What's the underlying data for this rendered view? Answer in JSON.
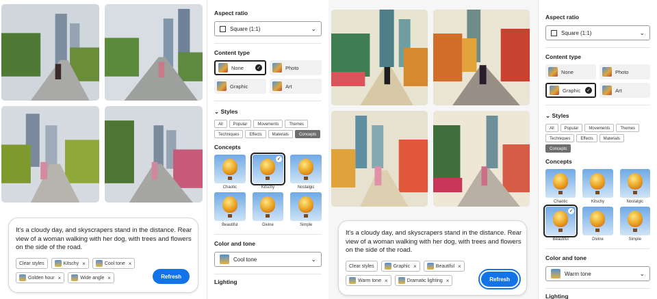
{
  "left": {
    "prompt": "It's a cloudy day, and skyscrapers stand in the distance. Rear view of a woman walking with her dog, with trees and flowers on the side of the road.",
    "chips": [
      {
        "label": "Clear styles",
        "icon": false,
        "remove": false
      },
      {
        "label": "Kitschy",
        "icon": true,
        "remove": true
      },
      {
        "label": "Cool tone",
        "icon": true,
        "remove": true
      },
      {
        "label": "Golden hour",
        "icon": true,
        "remove": true
      },
      {
        "label": "Wide angle",
        "icon": true,
        "remove": true
      }
    ],
    "refresh": "Refresh",
    "aspect_title": "Aspect ratio",
    "aspect_value": "Square (1:1)",
    "content_title": "Content type",
    "content": [
      {
        "label": "None",
        "selected": true
      },
      {
        "label": "Photo",
        "selected": false
      },
      {
        "label": "Graphic",
        "selected": false
      },
      {
        "label": "Art",
        "selected": false
      }
    ],
    "styles_title": "Styles",
    "tabs": [
      "All",
      "Popular",
      "Movements",
      "Themes",
      "Techniques",
      "Effects",
      "Materials",
      "Concepts"
    ],
    "active_tab": "Concepts",
    "concepts_title": "Concepts",
    "concepts": [
      {
        "label": "Chaotic",
        "selected": false
      },
      {
        "label": "Kitschy",
        "selected": true
      },
      {
        "label": "Nostalgic",
        "selected": false
      },
      {
        "label": "Beautiful",
        "selected": false
      },
      {
        "label": "Divine",
        "selected": false
      },
      {
        "label": "Simple",
        "selected": false
      }
    ],
    "color_title": "Color and tone",
    "color_value": "Cool tone",
    "lighting_title": "Lighting"
  },
  "right": {
    "prompt": "It's a cloudy day, and skyscrapers stand in the distance. Rear view of a woman walking with her dog, with trees and flowers on the side of the road.",
    "chips": [
      {
        "label": "Clear styles",
        "icon": false,
        "remove": false
      },
      {
        "label": "Graphic",
        "icon": true,
        "remove": true
      },
      {
        "label": "Beautiful",
        "icon": true,
        "remove": true
      },
      {
        "label": "Warm tone",
        "icon": true,
        "remove": true
      },
      {
        "label": "Dramatic lighting",
        "icon": true,
        "remove": true
      }
    ],
    "refresh": "Refresh",
    "aspect_title": "Aspect ratio",
    "aspect_value": "Square (1:1)",
    "content_title": "Content type",
    "content": [
      {
        "label": "None",
        "selected": false
      },
      {
        "label": "Photo",
        "selected": false
      },
      {
        "label": "Graphic",
        "selected": true
      },
      {
        "label": "Art",
        "selected": false
      }
    ],
    "styles_title": "Styles",
    "tabs": [
      "All",
      "Popular",
      "Movements",
      "Themes",
      "Techniques",
      "Effects",
      "Materials",
      "Concepts"
    ],
    "active_tab": "Concepts",
    "concepts_title": "Concepts",
    "concepts": [
      {
        "label": "Chaotic",
        "selected": false
      },
      {
        "label": "Kitschy",
        "selected": false
      },
      {
        "label": "Nostalgic",
        "selected": false
      },
      {
        "label": "Beautiful",
        "selected": true
      },
      {
        "label": "Divine",
        "selected": false
      },
      {
        "label": "Simple",
        "selected": false
      }
    ],
    "color_title": "Color and tone",
    "color_value": "Warm tone",
    "lighting_title": "Lighting"
  },
  "colors": {
    "accent": "#1473e6",
    "selected_border": "#222222"
  }
}
